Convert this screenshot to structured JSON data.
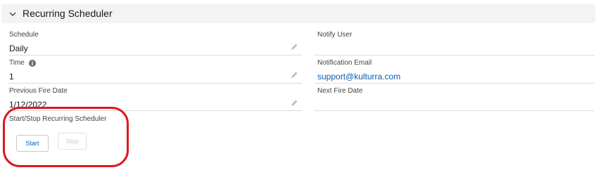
{
  "section": {
    "title": "Recurring Scheduler"
  },
  "left_fields": [
    {
      "label": "Schedule",
      "value": "Daily"
    },
    {
      "label": "Time",
      "value": "1"
    },
    {
      "label": "Previous Fire Date",
      "value": "1/12/2022"
    }
  ],
  "right_fields": [
    {
      "label": "Notify User",
      "value": ""
    },
    {
      "label": "Notification Email",
      "value": "support@kulturra.com"
    },
    {
      "label": "Next Fire Date",
      "value": ""
    }
  ],
  "controls": {
    "label": "Start/Stop Recurring Scheduler",
    "start_label": "Start",
    "stop_label": "Stop"
  },
  "colors": {
    "link": "#0b5cab",
    "highlight": "#e1161e"
  }
}
